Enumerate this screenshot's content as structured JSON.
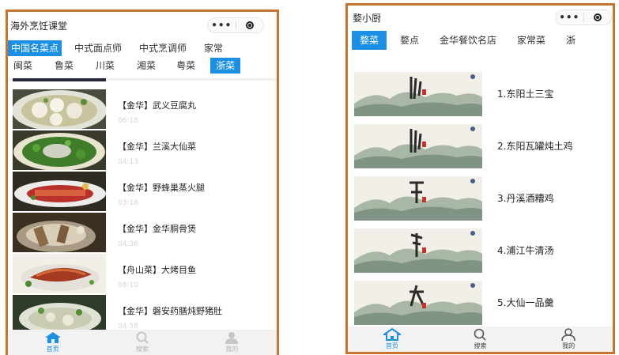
{
  "left": {
    "app_title": "海外烹饪课堂",
    "capsule": {
      "more": "•••",
      "close_icon": "target-icon"
    },
    "primary_tabs": [
      {
        "label": "中国名菜点",
        "active": true
      },
      {
        "label": "中式面点师",
        "active": false
      },
      {
        "label": "中式烹调师",
        "active": false
      },
      {
        "label": "家常",
        "active": false
      }
    ],
    "secondary_tabs": [
      {
        "label": "闽菜",
        "active": false
      },
      {
        "label": "鲁菜",
        "active": false
      },
      {
        "label": "川菜",
        "active": false
      },
      {
        "label": "湘菜",
        "active": false
      },
      {
        "label": "粤菜",
        "active": false
      },
      {
        "label": "浙菜",
        "active": true
      }
    ],
    "items": [
      {
        "title": "【金华】武义豆腐丸",
        "duration": "06:18"
      },
      {
        "title": "【金华】兰溪大仙菜",
        "duration": "04:13"
      },
      {
        "title": "【金华】野蜂巢蒸火腿",
        "duration": "03:16"
      },
      {
        "title": "【金华】金华胴骨煲",
        "duration": "04:36"
      },
      {
        "title": "【舟山菜】大烤目鱼",
        "duration": "08:10"
      },
      {
        "title": "【金华】磐安药膳炖野猪肚",
        "duration": "04:58"
      }
    ],
    "nav": [
      {
        "label": "首页",
        "icon": "home-icon",
        "active": true
      },
      {
        "label": "搜索",
        "icon": "search-icon",
        "active": false
      },
      {
        "label": "我的",
        "icon": "user-icon",
        "active": false
      }
    ]
  },
  "right": {
    "app_title": "婺小厨",
    "capsule": {
      "more": "•••",
      "close_icon": "target-icon"
    },
    "tabs": [
      {
        "label": "婺菜",
        "active": true
      },
      {
        "label": "婺点",
        "active": false
      },
      {
        "label": "金华餐饮名店",
        "active": false
      },
      {
        "label": "家常菜",
        "active": false
      },
      {
        "label": "浙",
        "active": false
      }
    ],
    "items": [
      {
        "title": "1.东阳土三宝"
      },
      {
        "title": "2.东阳瓦罐炖土鸡"
      },
      {
        "title": "3.丹溪酒糟鸡"
      },
      {
        "title": "4.浦江牛清汤"
      },
      {
        "title": "5.大仙一品羹"
      }
    ],
    "nav": [
      {
        "label": "首页",
        "icon": "home-icon",
        "active": true
      },
      {
        "label": "搜索",
        "icon": "search-icon",
        "active": false
      },
      {
        "label": "我的",
        "icon": "user-icon",
        "active": false
      }
    ],
    "colors": {
      "accent": "#1a8fe3",
      "frame": "#c8742c"
    }
  }
}
